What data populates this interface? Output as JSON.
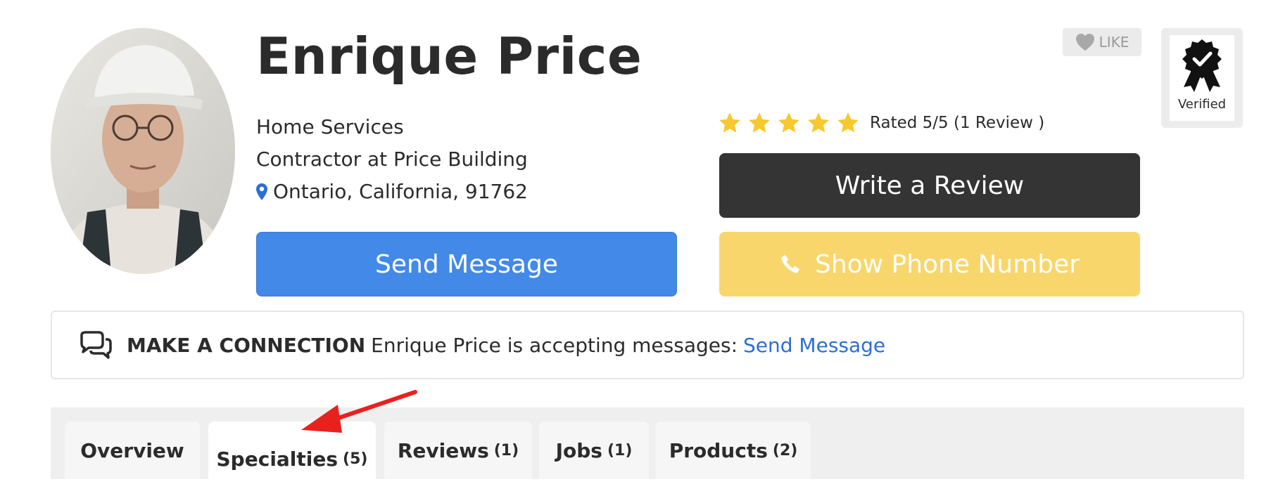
{
  "profile": {
    "name": "Enrique Price",
    "category": "Home Services",
    "title": "Contractor at Price Building",
    "location": "Ontario, California, 91762"
  },
  "rating": {
    "stars": 5,
    "max_stars": 5,
    "text": "Rated 5/5 (1 Review )",
    "star_color": "#f7c82f"
  },
  "actions": {
    "send_message": "Send Message",
    "write_review": "Write a Review",
    "show_phone": "Show Phone Number",
    "like": "LIKE"
  },
  "badge": {
    "label": "Verified"
  },
  "connection": {
    "heading": "MAKE A CONNECTION",
    "text": "Enrique Price is accepting messages:",
    "link": "Send Message"
  },
  "tabs": [
    {
      "label": "Overview",
      "count": ""
    },
    {
      "label": "Specialties",
      "count": "(5)"
    },
    {
      "label": "Reviews",
      "count": "(1)"
    },
    {
      "label": "Jobs",
      "count": "(1)"
    },
    {
      "label": "Products",
      "count": "(2)"
    }
  ],
  "active_tab": "Specialties",
  "colors": {
    "primary_blue": "#4289e8",
    "dark_button": "#343434",
    "phone_yellow": "#f8d66b",
    "link_blue": "#2a6fd6",
    "annotation_arrow": "#e8211f"
  },
  "icons": [
    "map-pin-icon",
    "star-icon",
    "heart-icon",
    "award-ribbon-icon",
    "phone-icon",
    "chat-bubbles-icon"
  ]
}
